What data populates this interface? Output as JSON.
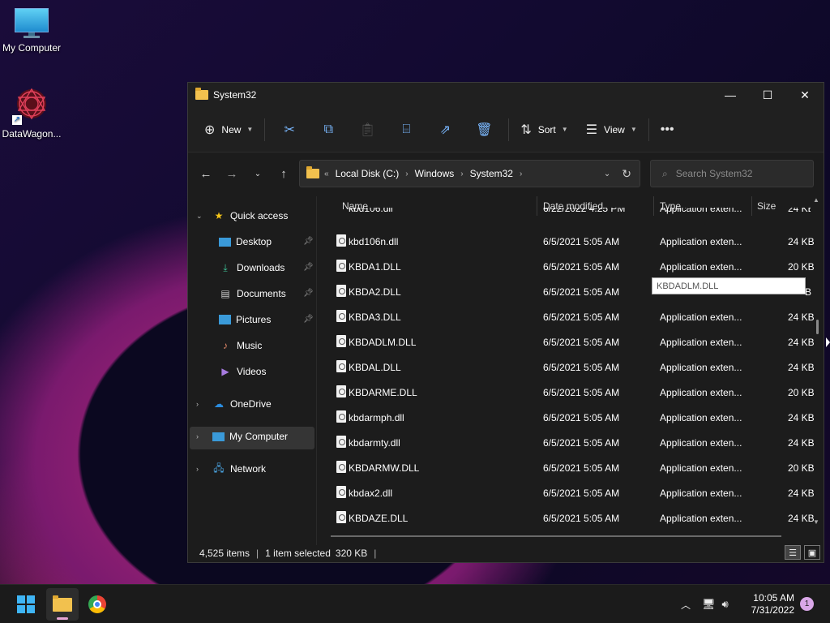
{
  "desktop": {
    "icons": [
      {
        "label": "My Computer",
        "icon": "monitor-icon"
      },
      {
        "label": "DataWagon...",
        "icon": "datawagon-icon"
      }
    ]
  },
  "window": {
    "title": "System32",
    "toolbar": {
      "new_label": "New",
      "sort_label": "Sort",
      "view_label": "View"
    },
    "address": {
      "crumbs": [
        "Local Disk (C:)",
        "Windows",
        "System32"
      ]
    },
    "search": {
      "placeholder": "Search System32"
    },
    "sidebar": {
      "quick_access": "Quick access",
      "items": [
        "Desktop",
        "Downloads",
        "Documents",
        "Pictures",
        "Music",
        "Videos"
      ],
      "onedrive": "OneDrive",
      "my_computer": "My Computer",
      "network": "Network"
    },
    "columns": {
      "name": "Name",
      "date": "Date modified",
      "type": "Type",
      "size": "Size"
    },
    "partial_row": {
      "name": "kbd106.dll",
      "date": "6/22/2022 4:25 PM",
      "type": "Application exten...",
      "size": "24 KB"
    },
    "rows": [
      {
        "name": "kbd106n.dll",
        "date": "6/5/2021 5:05 AM",
        "type": "Application exten...",
        "size": "24 KB"
      },
      {
        "name": "KBDA1.DLL",
        "date": "6/5/2021 5:05 AM",
        "type": "Application exten...",
        "size": "20 KB"
      },
      {
        "name": "KBDA2.DLL",
        "date": "6/5/2021 5:05 AM",
        "type": "",
        "size": "B"
      },
      {
        "name": "KBDA3.DLL",
        "date": "6/5/2021 5:05 AM",
        "type": "Application exten...",
        "size": "24 KB"
      },
      {
        "name": "KBDADLM.DLL",
        "date": "6/5/2021 5:05 AM",
        "type": "Application exten...",
        "size": "24 KB"
      },
      {
        "name": "KBDAL.DLL",
        "date": "6/5/2021 5:05 AM",
        "type": "Application exten...",
        "size": "24 KB"
      },
      {
        "name": "KBDARME.DLL",
        "date": "6/5/2021 5:05 AM",
        "type": "Application exten...",
        "size": "20 KB"
      },
      {
        "name": "kbdarmph.dll",
        "date": "6/5/2021 5:05 AM",
        "type": "Application exten...",
        "size": "24 KB"
      },
      {
        "name": "kbdarmty.dll",
        "date": "6/5/2021 5:05 AM",
        "type": "Application exten...",
        "size": "24 KB"
      },
      {
        "name": "KBDARMW.DLL",
        "date": "6/5/2021 5:05 AM",
        "type": "Application exten...",
        "size": "20 KB"
      },
      {
        "name": "kbdax2.dll",
        "date": "6/5/2021 5:05 AM",
        "type": "Application exten...",
        "size": "24 KB"
      },
      {
        "name": "KBDAZE.DLL",
        "date": "6/5/2021 5:05 AM",
        "type": "Application exten...",
        "size": "24 KB"
      }
    ],
    "tooltip": "KBDADLM.DLL",
    "status": {
      "items": "4,525 items",
      "selected": "1 item selected",
      "size": "320 KB"
    }
  },
  "taskbar": {
    "time": "10:05 AM",
    "date": "7/31/2022",
    "notification_count": "1"
  }
}
